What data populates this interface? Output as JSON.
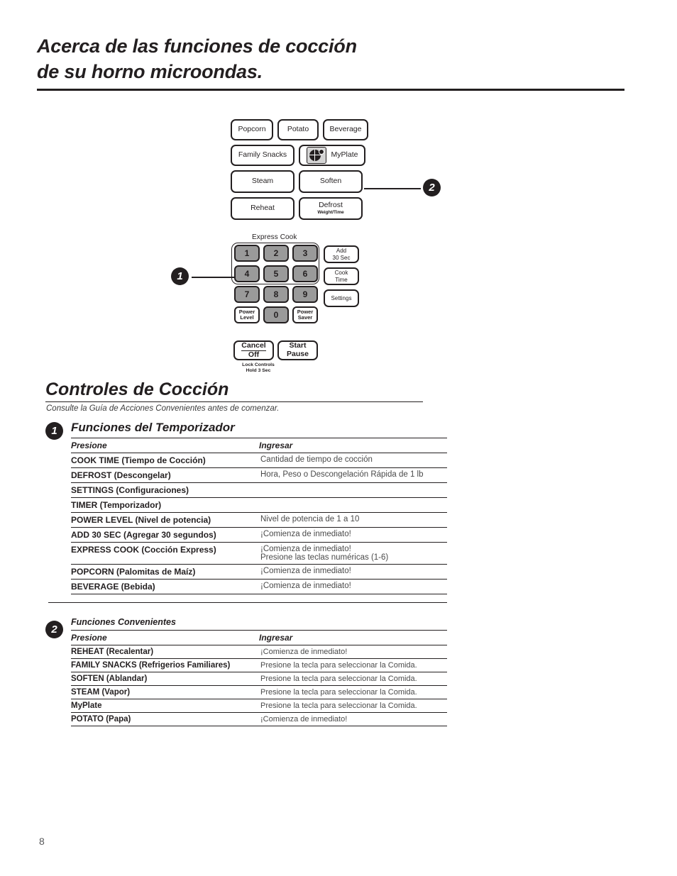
{
  "header": {
    "title_line1": "Acerca de las funciones de cocción",
    "title_line2": "de su horno microondas."
  },
  "panel": {
    "row1": [
      {
        "label": "Popcorn"
      },
      {
        "label": "Potato"
      },
      {
        "label": "Beverage"
      }
    ],
    "row2": [
      {
        "label": "Family Snacks"
      },
      {
        "label": "MyPlate",
        "icon": "myplate-icon"
      }
    ],
    "row3": [
      {
        "label": "Steam"
      },
      {
        "label": "Soften"
      }
    ],
    "row4": [
      {
        "label": "Reheat"
      },
      {
        "label": "Defrost",
        "sub": "Weight/Time"
      }
    ],
    "express_label": "Express Cook",
    "keys": {
      "row1": [
        "1",
        "2",
        "3"
      ],
      "row2": [
        "4",
        "5",
        "6"
      ],
      "row3": [
        "7",
        "8",
        "9"
      ],
      "power_level": {
        "line1": "Power",
        "line2": "Level"
      },
      "zero": "0",
      "power_saver": {
        "line1": "Power",
        "line2": "Saver"
      }
    },
    "side_buttons": [
      {
        "line1": "Add",
        "line2": "30 Sec"
      },
      {
        "line1": "Cook",
        "line2": "Time"
      },
      {
        "line1": "Settings",
        "line2": ""
      }
    ],
    "cancel": {
      "line1": "Cancel",
      "line2": "Off"
    },
    "start": {
      "line1": "Start",
      "line2": "Pause"
    },
    "lock_note_line1": "Lock Controls",
    "lock_note_line2": "Hold 3 Sec",
    "callout_1": "1",
    "callout_2": "2"
  },
  "section": {
    "title": "Controles de Cocción",
    "subtitle": "Consulte la Guía de Acciones Convenientes antes de comenzar."
  },
  "block_1": {
    "badge": "1",
    "title": "Funciones del Temporizador",
    "columns": [
      "Presione",
      "Ingresar"
    ],
    "rows": [
      {
        "press": "COOK TIME (Tiempo de Cocción)",
        "enter": "Cantidad de tiempo de cocción",
        "enter2": ""
      },
      {
        "press": "DEFROST (Descongelar)",
        "enter": "Hora, Peso o Descongelación Rápida de 1 lb",
        "enter2": ""
      },
      {
        "press": "SETTINGS (Configuraciones)",
        "enter": "",
        "enter2": ""
      },
      {
        "press": "TIMER (Temporizador)",
        "enter": "",
        "enter2": ""
      },
      {
        "press": "POWER LEVEL (Nivel de potencia)",
        "enter": "Nivel de potencia de 1 a 10",
        "enter2": ""
      },
      {
        "press": "ADD 30 SEC (Agregar 30 segundos)",
        "enter": "¡Comienza de inmediato!",
        "enter2": ""
      },
      {
        "press": "EXPRESS COOK (Cocción Express)",
        "enter": "¡Comienza de inmediato!",
        "enter2": "Presione las teclas numéricas (1-6)"
      },
      {
        "press": "POPCORN (Palomitas de Maíz)",
        "enter": "¡Comienza de inmediato!",
        "enter2": ""
      },
      {
        "press": "BEVERAGE (Bebida)",
        "enter": "¡Comienza de inmediato!",
        "enter2": ""
      }
    ]
  },
  "block_2": {
    "badge": "2",
    "title": "Funciones Convenientes",
    "columns": [
      "Presione",
      "Ingresar"
    ],
    "rows": [
      {
        "press": "REHEAT (Recalentar)",
        "enter": "¡Comienza de inmediato!",
        "enter2": ""
      },
      {
        "press": "FAMILY SNACKS (Refrigerios Familiares)",
        "enter": "Presione la tecla para seleccionar la Comida.",
        "enter2": ""
      },
      {
        "press": "SOFTEN (Ablandar)",
        "enter": "Presione la tecla para seleccionar la Comida.",
        "enter2": ""
      },
      {
        "press": "STEAM (Vapor)",
        "enter": "Presione la tecla para seleccionar la Comida.",
        "enter2": ""
      },
      {
        "press": "MyPlate",
        "enter": "Presione la tecla para seleccionar la Comida.",
        "enter2": ""
      },
      {
        "press": "POTATO (Papa)",
        "enter": "¡Comienza de inmediato!",
        "enter2": ""
      }
    ]
  },
  "footer": {
    "page_number": "8"
  },
  "colors": {
    "ink": "#231f20",
    "key_gray": "#9a9a9a",
    "muted_text": "#4a4a4a"
  }
}
